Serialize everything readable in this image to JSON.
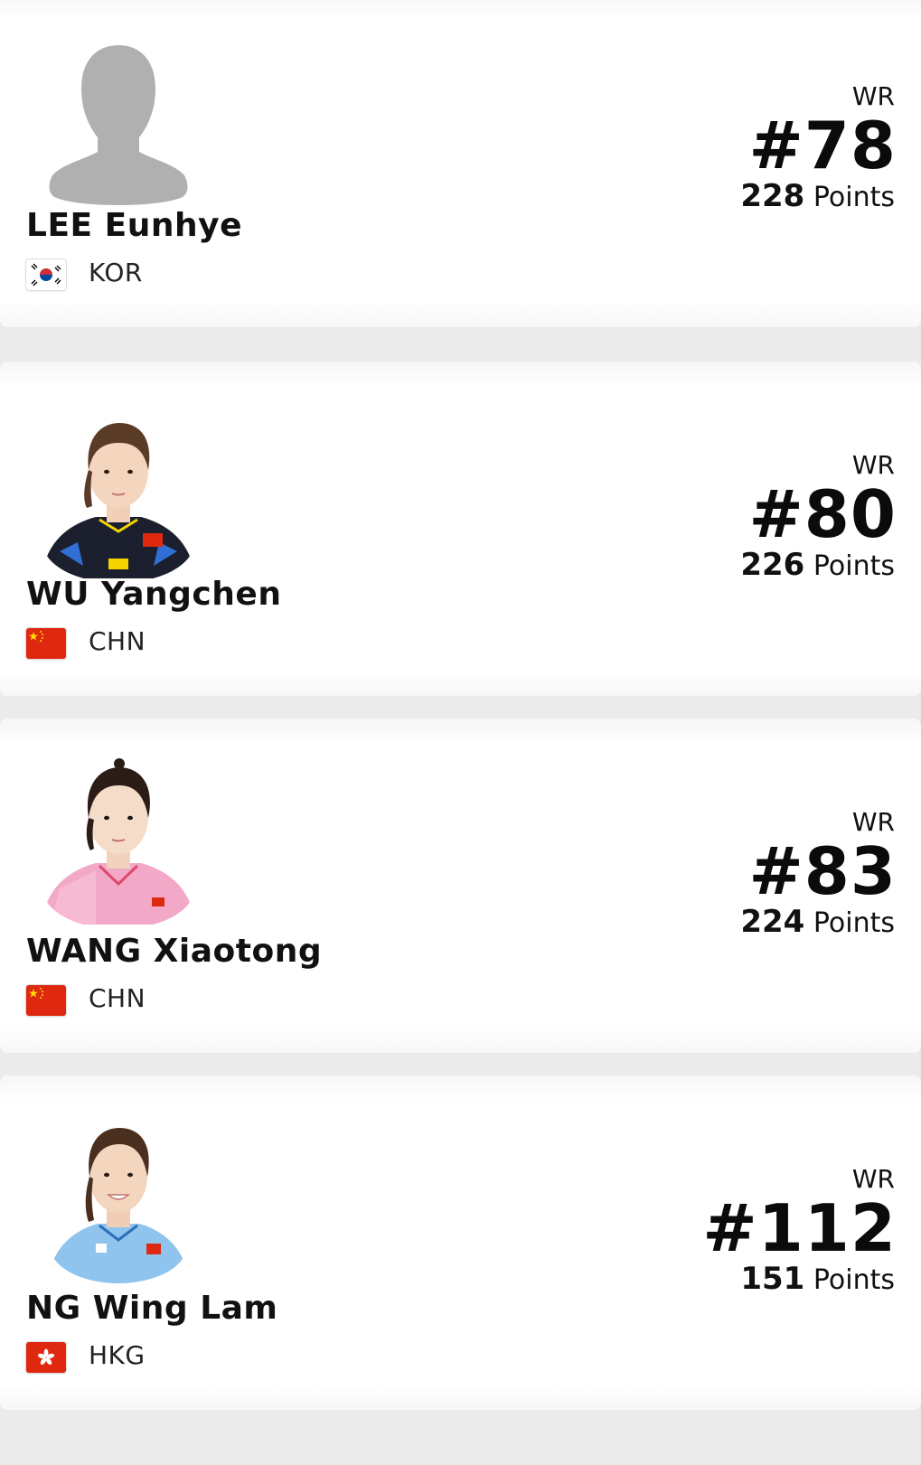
{
  "players": [
    {
      "name": "LEE Eunhye",
      "country": "KOR",
      "flag": "south-korea-flag",
      "avatar": "placeholder-silhouette",
      "wr_label": "WR",
      "rank": "#78",
      "points_value": "228",
      "points_label": "Points"
    },
    {
      "name": "WU Yangchen",
      "country": "CHN",
      "flag": "china-flag",
      "avatar": "player-photo",
      "shirt_color": "#1b1f2e",
      "wr_label": "WR",
      "rank": "#80",
      "points_value": "226",
      "points_label": "Points"
    },
    {
      "name": "WANG Xiaotong",
      "country": "CHN",
      "flag": "china-flag",
      "avatar": "player-photo",
      "shirt_color": "#f2a9c8",
      "wr_label": "WR",
      "rank": "#83",
      "points_value": "224",
      "points_label": "Points"
    },
    {
      "name": "NG Wing Lam",
      "country": "HKG",
      "flag": "hong-kong-flag",
      "avatar": "player-photo",
      "shirt_color": "#8fc4ee",
      "wr_label": "WR",
      "rank": "#112",
      "points_value": "151",
      "points_label": "Points"
    }
  ]
}
